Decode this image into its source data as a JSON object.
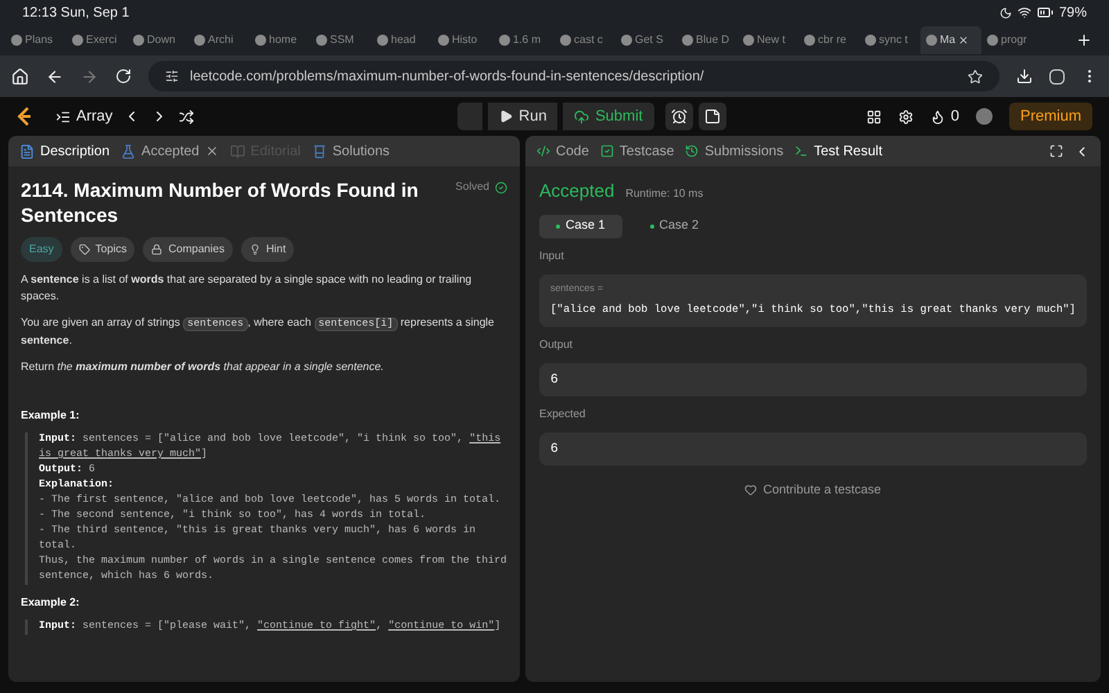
{
  "status_bar": {
    "time": "12:13 Sun, Sep 1",
    "battery": "79%"
  },
  "browser_tabs": [
    {
      "label": "Plans",
      "selected": false
    },
    {
      "label": "Exerci",
      "selected": false
    },
    {
      "label": "Down",
      "selected": false
    },
    {
      "label": "Archi",
      "selected": false
    },
    {
      "label": "home",
      "selected": false
    },
    {
      "label": "SSM",
      "selected": false
    },
    {
      "label": "head",
      "selected": false
    },
    {
      "label": "Histo",
      "selected": false
    },
    {
      "label": "1.6 m",
      "selected": false
    },
    {
      "label": "cast c",
      "selected": false
    },
    {
      "label": "Get S",
      "selected": false
    },
    {
      "label": "Blue D",
      "selected": false
    },
    {
      "label": "New t",
      "selected": false
    },
    {
      "label": "cbr re",
      "selected": false
    },
    {
      "label": "sync t",
      "selected": false
    },
    {
      "label": "Ma",
      "selected": true
    },
    {
      "label": "progr",
      "selected": false
    }
  ],
  "address_bar": {
    "url": "leetcode.com/problems/maximum-number-of-words-found-in-sentences/description/"
  },
  "nav": {
    "problem_list": "Array",
    "run": "Run",
    "submit": "Submit",
    "streak": "0",
    "premium": "Premium"
  },
  "left_tabs": [
    {
      "label": "Description",
      "selected": true,
      "disabled": false,
      "closable": false
    },
    {
      "label": "Accepted",
      "selected": false,
      "disabled": false,
      "closable": true
    },
    {
      "label": "Editorial",
      "selected": false,
      "disabled": true,
      "closable": false
    },
    {
      "label": "Solutions",
      "selected": false,
      "disabled": false,
      "closable": false
    }
  ],
  "problem": {
    "title": "2114. Maximum Number of Words Found in Sentences",
    "status": "Solved",
    "difficulty": "Easy",
    "tags": [
      "Topics",
      "Companies",
      "Hint"
    ],
    "paragraphs": [
      [
        {
          "kind": "text",
          "text": "A **sentence** is a list of **words** that are separated by a single space with no leading or trailing spaces."
        }
      ],
      [
        {
          "kind": "text",
          "text": "You are given an array of strings "
        },
        {
          "kind": "code",
          "text": "sentences"
        },
        {
          "kind": "text",
          "text": ", where each "
        },
        {
          "kind": "code",
          "text": "sentences[i]"
        },
        {
          "kind": "text",
          "text": " represents a single **sentence**."
        }
      ],
      [
        {
          "kind": "text",
          "text": "Return "
        },
        {
          "kind": "italic",
          "text": "the **maximum number of words** that appear in a single sentence."
        }
      ]
    ],
    "examples": [
      {
        "title": "Example 1:",
        "lines": [
          [
            {
              "kind": "label",
              "text": "Input:"
            },
            {
              "kind": "text",
              "text": " sentences = [\"alice and bob love leetcode\", \"i think so too\", "
            },
            {
              "kind": "link",
              "text": "\"this is great thanks very much\""
            },
            {
              "kind": "text",
              "text": "]"
            }
          ],
          [
            {
              "kind": "label",
              "text": "Output:"
            },
            {
              "kind": "text",
              "text": " 6"
            }
          ],
          [
            {
              "kind": "label",
              "text": "Explanation:"
            }
          ],
          [
            {
              "kind": "text",
              "text": "- The first sentence, \"alice and bob love leetcode\", has 5 words in total."
            }
          ],
          [
            {
              "kind": "text",
              "text": "- The second sentence, \"i think so too\", has 4 words in total."
            }
          ],
          [
            {
              "kind": "text",
              "text": "- The third sentence, \"this is great thanks very much\", has 6 words in total."
            }
          ],
          [
            {
              "kind": "text",
              "text": "Thus, the maximum number of words in a single sentence comes from the third sentence, which has 6 words."
            }
          ]
        ]
      },
      {
        "title": "Example 2:",
        "lines": [
          [
            {
              "kind": "label",
              "text": "Input:"
            },
            {
              "kind": "text",
              "text": " sentences = [\"please wait\", "
            },
            {
              "kind": "link",
              "text": "\"continue to fight\""
            },
            {
              "kind": "text",
              "text": ", "
            },
            {
              "kind": "link",
              "text": "\"continue to win\""
            },
            {
              "kind": "text",
              "text": "]"
            }
          ]
        ]
      }
    ]
  },
  "right_tabs": [
    {
      "label": "Code",
      "selected": false
    },
    {
      "label": "Testcase",
      "selected": false
    },
    {
      "label": "Submissions",
      "selected": false
    },
    {
      "label": "Test Result",
      "selected": true
    }
  ],
  "result": {
    "verdict": "Accepted",
    "runtime": "Runtime: 10 ms",
    "cases": [
      {
        "label": "Case 1",
        "selected": true
      },
      {
        "label": "Case 2",
        "selected": false
      }
    ],
    "input_label": "Input",
    "param_name": "sentences =",
    "param_value": "[\"alice and bob love leetcode\",\"i think so too\",\"this is great thanks very much\"]",
    "output_label": "Output",
    "output": "6",
    "expected_label": "Expected",
    "expected": "6",
    "contribute": "Contribute a testcase"
  }
}
